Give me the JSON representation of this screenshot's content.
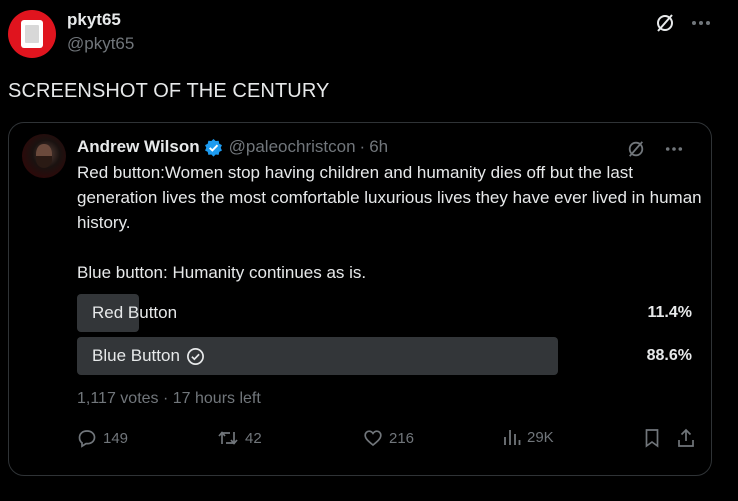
{
  "post": {
    "display_name": "pkyt65",
    "handle": "@pkyt65",
    "text": "SCREENSHOT OF THE CENTURY",
    "avatar_icon": "book-icon",
    "colors": {
      "avatar_bg": "#e0141e"
    }
  },
  "quoted": {
    "display_name": "Andrew Wilson",
    "handle": "@paleochristcon",
    "separator": "·",
    "time": "6h",
    "verified_icon": "verified-badge-icon",
    "body_paragraph_1": "Red button:Women stop having children and humanity dies off but the last generation lives the most comfortable luxurious lives they have ever lived in human history.",
    "body_paragraph_2": "Blue button: Humanity continues as is.",
    "poll": {
      "options": [
        {
          "label": "Red Button",
          "percent_text": "11.4%",
          "percent": 11.4,
          "winner": false
        },
        {
          "label": "Blue Button",
          "percent_text": "88.6%",
          "percent": 88.6,
          "winner": true
        }
      ],
      "meta": "1,117 votes · 17 hours left"
    },
    "actions": {
      "replies": "149",
      "reposts": "42",
      "likes": "216",
      "views": "29K"
    }
  },
  "colors": {
    "background": "#000000",
    "text_primary": "#e7e9ea",
    "text_secondary": "#71767b",
    "border": "#2f3336",
    "poll_bar": "#333639",
    "verified": "#1d9bf0"
  }
}
